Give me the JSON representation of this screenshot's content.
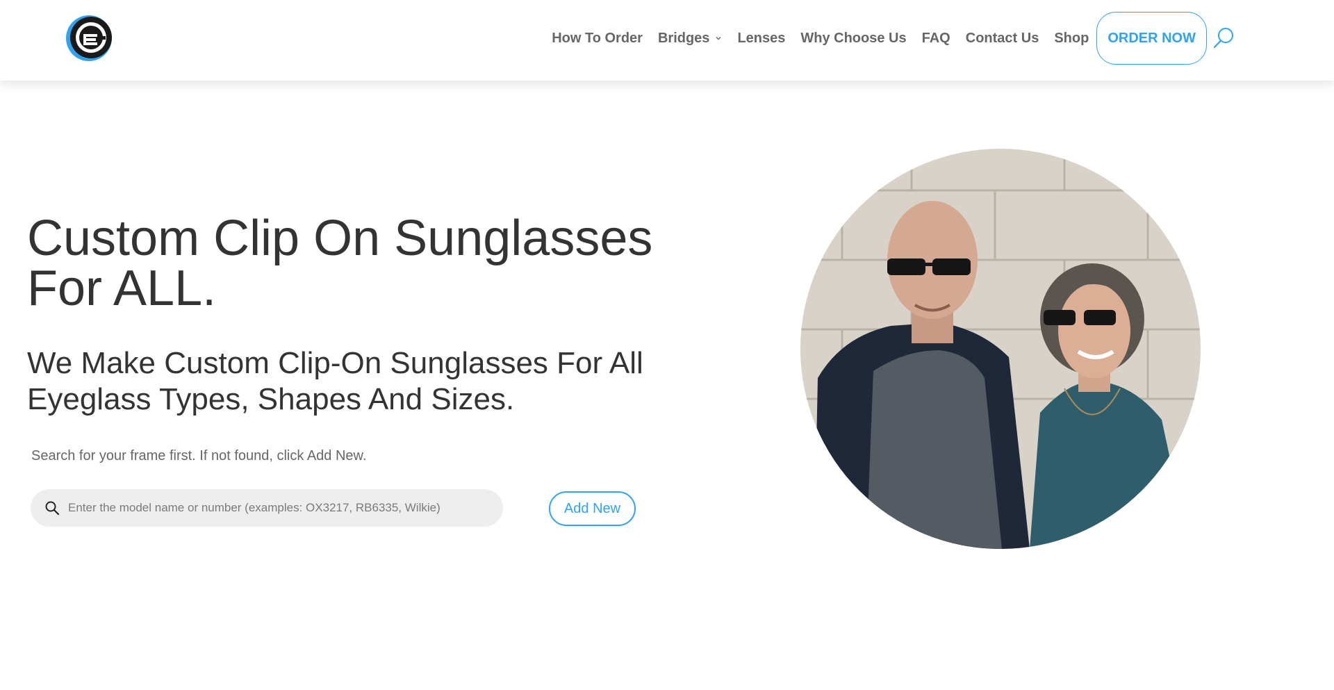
{
  "header": {
    "nav": [
      {
        "label": "How To Order"
      },
      {
        "label": "Bridges"
      },
      {
        "label": "Lenses"
      },
      {
        "label": "Why Choose Us"
      },
      {
        "label": "FAQ"
      },
      {
        "label": "Contact Us"
      },
      {
        "label": "Shop"
      }
    ],
    "order_label": "ORDER NOW",
    "logo_icon": "ce-logo-icon",
    "search_icon": "search-icon"
  },
  "hero": {
    "title": "Custom Clip On Sunglasses For ALL.",
    "subtitle": "We Make Custom Clip-On Sunglasses For All Eyeglass Types, Shapes And Sizes.",
    "hint": "Search for your frame first. If not found, click Add New.",
    "search_placeholder": "Enter the model name or number (examples: OX3217, RB6335, Wilkie)",
    "add_label": "Add New"
  },
  "colors": {
    "accent": "#2ea3f2",
    "nav_text": "#666666",
    "heading": "#333333",
    "search_bg": "#eeeeee"
  }
}
